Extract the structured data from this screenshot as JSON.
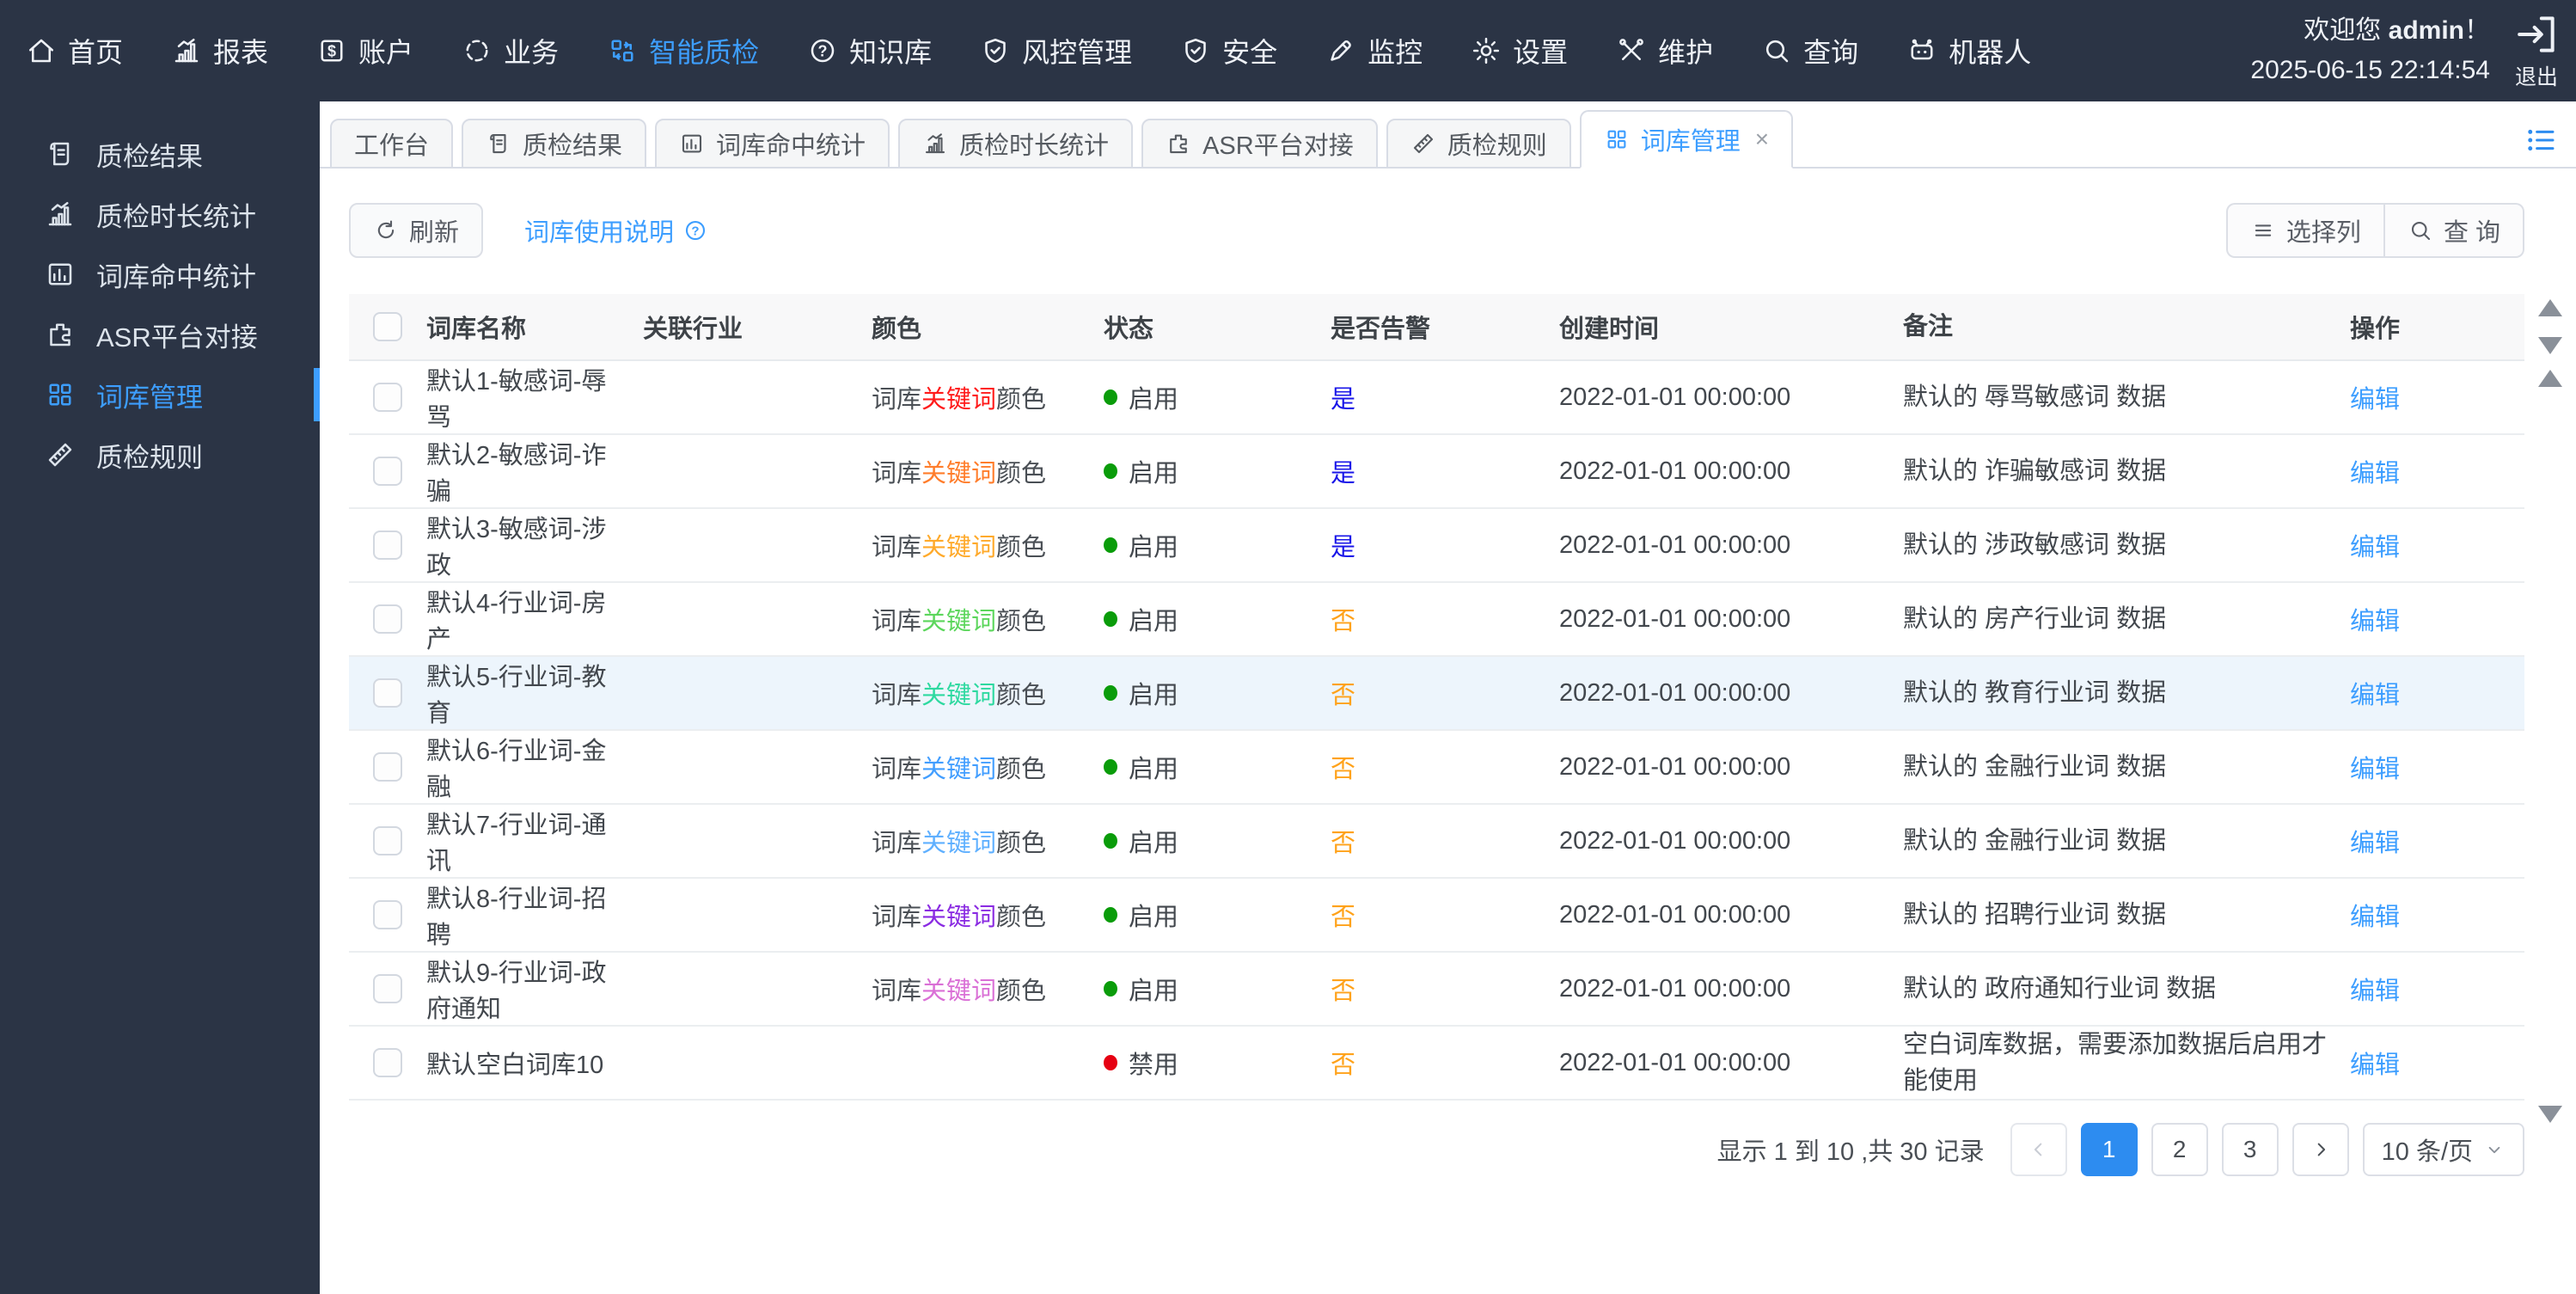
{
  "header": {
    "welcome_prefix": "欢迎您",
    "username": "admin",
    "welcome_suffix": "！",
    "datetime": "2025-06-15 22:14:54",
    "logout_label": "退出",
    "nav": [
      {
        "id": "home",
        "label": "首页",
        "icon": "home",
        "active": false
      },
      {
        "id": "reports",
        "label": "报表",
        "icon": "bar-chart",
        "active": false
      },
      {
        "id": "accounts",
        "label": "账户",
        "icon": "dollar-card",
        "active": false
      },
      {
        "id": "business",
        "label": "业务",
        "icon": "circle-dash",
        "active": false
      },
      {
        "id": "smart-qc",
        "label": "智能质检",
        "icon": "repeat",
        "active": true
      },
      {
        "id": "knowledge",
        "label": "知识库",
        "icon": "question-circle",
        "active": false
      },
      {
        "id": "risk",
        "label": "风控管理",
        "icon": "shield-check",
        "active": false
      },
      {
        "id": "security",
        "label": "安全",
        "icon": "shield-check",
        "active": false
      },
      {
        "id": "monitor",
        "label": "监控",
        "icon": "pen",
        "active": false
      },
      {
        "id": "settings",
        "label": "设置",
        "icon": "gear",
        "active": false
      },
      {
        "id": "maintain",
        "label": "维护",
        "icon": "tools",
        "active": false
      },
      {
        "id": "query",
        "label": "查询",
        "icon": "search",
        "active": false
      },
      {
        "id": "robot",
        "label": "机器人",
        "icon": "robot",
        "active": false
      }
    ]
  },
  "sidebar": {
    "items": [
      {
        "id": "qc-result",
        "label": "质检结果",
        "icon": "scroll",
        "active": false
      },
      {
        "id": "qc-duration",
        "label": "质检时长统计",
        "icon": "bar-chart",
        "active": false
      },
      {
        "id": "lexicon-hits",
        "label": "词库命中统计",
        "icon": "chart-box",
        "active": false
      },
      {
        "id": "asr-platform",
        "label": "ASR平台对接",
        "icon": "puzzle",
        "active": false
      },
      {
        "id": "lexicon-manage",
        "label": "词库管理",
        "icon": "grid",
        "active": true
      },
      {
        "id": "qc-rules",
        "label": "质检规则",
        "icon": "ruler-pen",
        "active": false
      }
    ]
  },
  "tabs": {
    "items": [
      {
        "id": "workbench",
        "label": "工作台",
        "icon": null,
        "active": false,
        "closable": false
      },
      {
        "id": "qc-result",
        "label": "质检结果",
        "icon": "scroll",
        "active": false,
        "closable": false
      },
      {
        "id": "lexicon-hits",
        "label": "词库命中统计",
        "icon": "chart-box",
        "active": false,
        "closable": false
      },
      {
        "id": "qc-duration",
        "label": "质检时长统计",
        "icon": "bar-chart",
        "active": false,
        "closable": false
      },
      {
        "id": "asr-platform",
        "label": "ASR平台对接",
        "icon": "puzzle",
        "active": false,
        "closable": false
      },
      {
        "id": "qc-rules",
        "label": "质检规则",
        "icon": "ruler-pen",
        "active": false,
        "closable": false
      },
      {
        "id": "lexicon-manage",
        "label": "词库管理",
        "icon": "grid",
        "active": true,
        "closable": true
      }
    ]
  },
  "toolbar": {
    "refresh_label": "刷新",
    "help_label": "词库使用说明",
    "columns_label": "选择列",
    "query_label": "查 询"
  },
  "table": {
    "columns": [
      "词库名称",
      "关联行业",
      "颜色",
      "状态",
      "是否告警",
      "创建时间",
      "备注",
      "操作"
    ],
    "color_cell": {
      "prefix": "词库",
      "keyword": "关键词",
      "suffix": "颜色"
    },
    "action_label": "编辑",
    "rows": [
      {
        "name": "默认1-敏感词-辱骂",
        "industry": "",
        "keyword_color": "#ff1a1a",
        "status": "启用",
        "status_on": true,
        "alarm": "是",
        "alarm_yes": true,
        "created": "2022-01-01 00:00:00",
        "remark": "默认的 辱骂敏感词 数据",
        "highlight": false
      },
      {
        "name": "默认2-敏感词-诈骗",
        "industry": "",
        "keyword_color": "#ff7d2b",
        "status": "启用",
        "status_on": true,
        "alarm": "是",
        "alarm_yes": true,
        "created": "2022-01-01 00:00:00",
        "remark": "默认的 诈骗敏感词 数据",
        "highlight": false
      },
      {
        "name": "默认3-敏感词-涉政",
        "industry": "",
        "keyword_color": "#ffaa2b",
        "status": "启用",
        "status_on": true,
        "alarm": "是",
        "alarm_yes": true,
        "created": "2022-01-01 00:00:00",
        "remark": "默认的 涉政敏感词 数据",
        "highlight": false
      },
      {
        "name": "默认4-行业词-房产",
        "industry": "",
        "keyword_color": "#5cd65c",
        "status": "启用",
        "status_on": true,
        "alarm": "否",
        "alarm_yes": false,
        "created": "2022-01-01 00:00:00",
        "remark": "默认的 房产行业词 数据",
        "highlight": false
      },
      {
        "name": "默认5-行业词-教育",
        "industry": "",
        "keyword_color": "#2ed9a0",
        "status": "启用",
        "status_on": true,
        "alarm": "否",
        "alarm_yes": false,
        "created": "2022-01-01 00:00:00",
        "remark": "默认的 教育行业词 数据",
        "highlight": true
      },
      {
        "name": "默认6-行业词-金融",
        "industry": "",
        "keyword_color": "#429eff",
        "status": "启用",
        "status_on": true,
        "alarm": "否",
        "alarm_yes": false,
        "created": "2022-01-01 00:00:00",
        "remark": "默认的 金融行业词 数据",
        "highlight": false
      },
      {
        "name": "默认7-行业词-通讯",
        "industry": "",
        "keyword_color": "#5fb0ff",
        "status": "启用",
        "status_on": true,
        "alarm": "否",
        "alarm_yes": false,
        "created": "2022-01-01 00:00:00",
        "remark": "默认的 金融行业词 数据",
        "highlight": false
      },
      {
        "name": "默认8-行业词-招聘",
        "industry": "",
        "keyword_color": "#8a2be2",
        "status": "启用",
        "status_on": true,
        "alarm": "否",
        "alarm_yes": false,
        "created": "2022-01-01 00:00:00",
        "remark": "默认的 招聘行业词 数据",
        "highlight": false
      },
      {
        "name": "默认9-行业词-政府通知",
        "industry": "",
        "keyword_color": "#da70d6",
        "status": "启用",
        "status_on": true,
        "alarm": "否",
        "alarm_yes": false,
        "created": "2022-01-01 00:00:00",
        "remark": "默认的 政府通知行业词 数据",
        "highlight": false
      },
      {
        "name": "默认空白词库10",
        "industry": "",
        "keyword_color": null,
        "status": "禁用",
        "status_on": false,
        "alarm": "否",
        "alarm_yes": false,
        "created": "2022-01-01 00:00:00",
        "remark": "空白词库数据，需要添加数据后启用才能使用",
        "highlight": false
      }
    ]
  },
  "pagination": {
    "summary": "显示 1 到 10 ,共 30 记录",
    "pages": [
      "1",
      "2",
      "3"
    ],
    "active_page": "1",
    "page_size": "10 条/页"
  },
  "colors": {
    "accent": "#3d9eff",
    "pagination_active": "#2d8cf0",
    "status_on": "#0a9c0a",
    "status_off": "#e60012",
    "alarm_yes": "#1a16e8",
    "alarm_no": "#ffa21a",
    "nav_bg": "#2b3445"
  }
}
